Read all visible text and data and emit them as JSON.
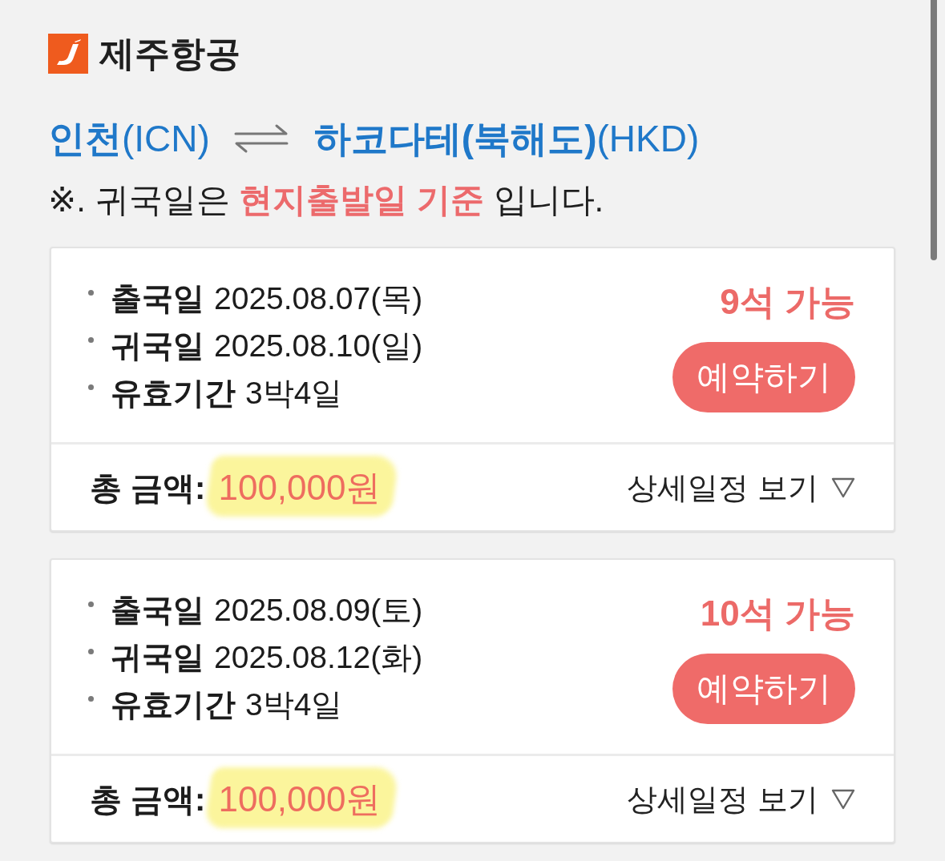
{
  "header": {
    "airline": "제주항공"
  },
  "route": {
    "origin_city": "인천",
    "origin_code": "(ICN)",
    "destination_city": "하코다테(북해도)",
    "destination_code": "(HKD)"
  },
  "notice": "※. 귀국일은 **현지출발일 기준** 입니다.",
  "flights": [
    {
      "details": [
        {
          "label": "출국일",
          "value": "2025.08.07(목)"
        },
        {
          "label": "귀국일",
          "value": "2025.08.10(일)"
        },
        {
          "label": "유효기간",
          "value": "3박4일"
        }
      ],
      "seats": "9석 가능",
      "book_button": "예약하기",
      "total_label": "총 금액:",
      "total_price": "100,000원",
      "price_highlighted": true,
      "details_link": "상세일정 보기",
      "expanded": false
    },
    {
      "details": [
        {
          "label": "출국일",
          "value": "2025.08.09(토)"
        },
        {
          "label": "귀국일",
          "value": "2025.08.12(화)"
        },
        {
          "label": "유효기간",
          "value": "3박4일"
        }
      ],
      "seats": "10석 가능",
      "book_button": "예약하기",
      "total_label": "총 금액:",
      "total_price": "100,000원",
      "price_highlighted": true,
      "details_link": "상세일정 보기",
      "expanded": false
    }
  ]
}
